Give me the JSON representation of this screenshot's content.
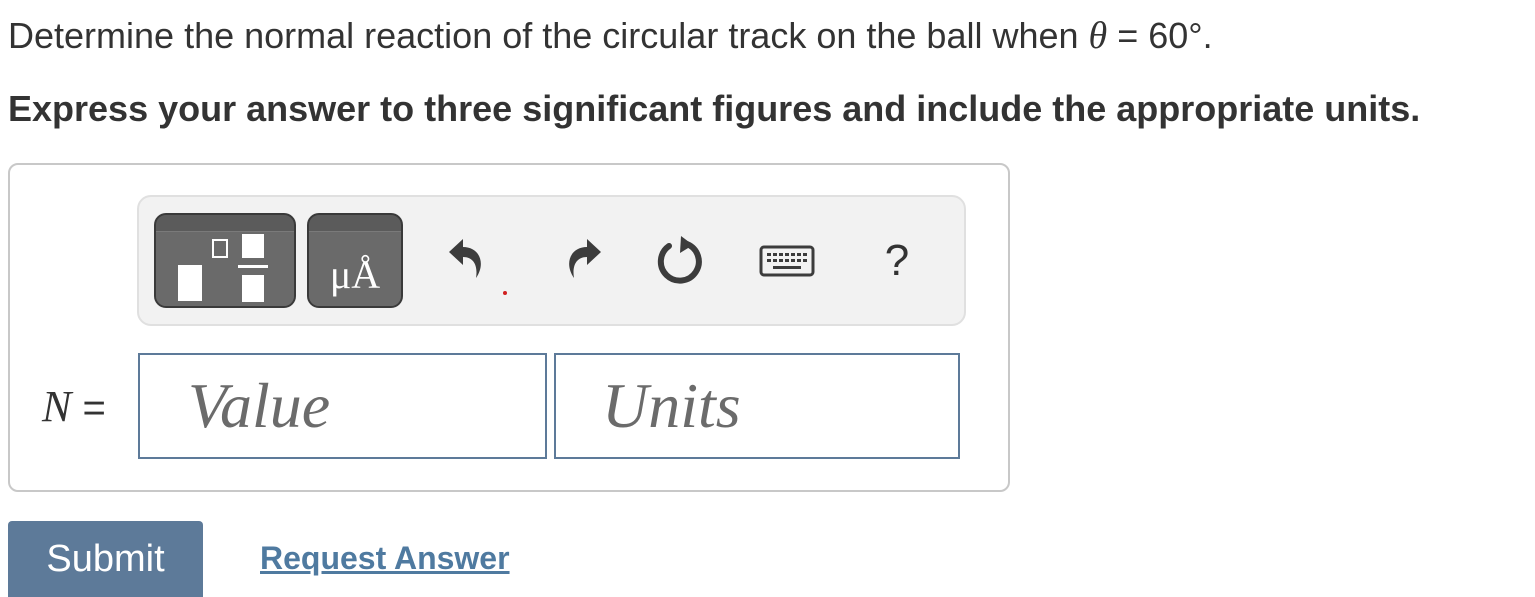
{
  "question": {
    "prefix": "Determine the normal reaction of the circular track on the ball when ",
    "symbol": "θ",
    "suffix": " = 60°."
  },
  "instruction": "Express your answer to three significant figures and include the appropriate units.",
  "toolbar": {
    "units_label": "μÅ",
    "help_label": "?",
    "icons": [
      "templates-icon",
      "units-icon",
      "undo-icon",
      "redo-icon",
      "reset-icon",
      "keyboard-icon",
      "help-icon"
    ]
  },
  "equation": {
    "variable": "N",
    "equals": " ="
  },
  "value_field": {
    "placeholder": "Value"
  },
  "units_field": {
    "placeholder": "Units"
  },
  "actions": {
    "submit_label": "Submit",
    "request_label": "Request Answer"
  },
  "colors": {
    "accent": "#5d7a99",
    "link": "#4f7aa0",
    "toolbar_button": "#5b5b5b"
  }
}
